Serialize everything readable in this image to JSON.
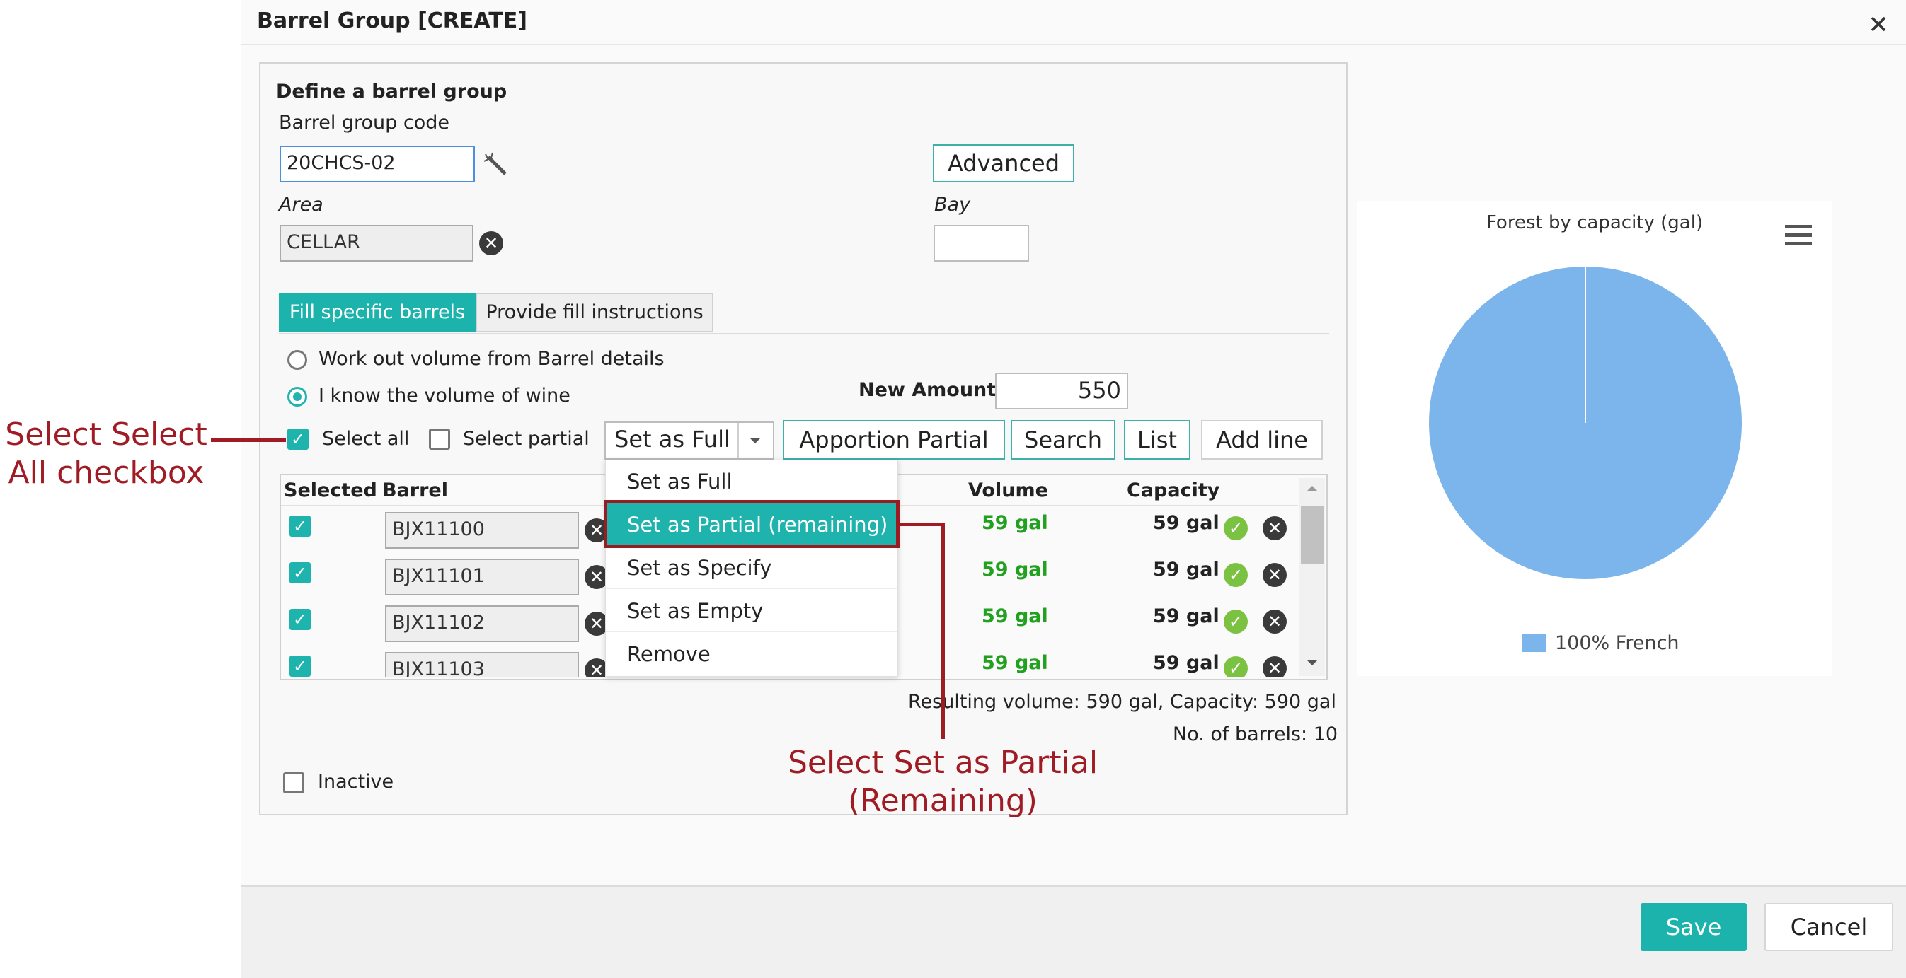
{
  "dialog": {
    "title": "Barrel Group [CREATE]"
  },
  "form": {
    "section_title": "Define a barrel group",
    "code_label": "Barrel group code",
    "code_value": "20CHCS-02",
    "advanced_label": "Advanced",
    "area_label": "Area",
    "area_value": "CELLAR",
    "bay_label": "Bay",
    "bay_value": ""
  },
  "tabs": [
    {
      "label": "Fill specific barrels",
      "active": true
    },
    {
      "label": "Provide fill instructions",
      "active": false
    }
  ],
  "volume_mode": {
    "option1": "Work out volume from Barrel details",
    "option2": "I know the volume of wine",
    "selected": 2
  },
  "new_amount": {
    "label": "New Amount",
    "value": "550"
  },
  "toolbar": {
    "select_all": "Select all",
    "select_partial": "Select partial",
    "fill_select": "Set as Full",
    "apportion": "Apportion Partial",
    "search": "Search",
    "list": "List",
    "add_line": "Add line"
  },
  "dropdown": {
    "items": [
      "Set as Full",
      "Set as Partial (remaining)",
      "Set as Specify",
      "Set as Empty",
      "Remove"
    ],
    "highlighted": 1
  },
  "table": {
    "headers": {
      "selected": "Selected",
      "barrel": "Barrel",
      "volume": "Volume",
      "capacity": "Capacity"
    },
    "rows": [
      {
        "barrel": "BJX11100",
        "volume": "59 gal",
        "capacity": "59 gal",
        "selected": true
      },
      {
        "barrel": "BJX11101",
        "volume": "59 gal",
        "capacity": "59 gal",
        "selected": true
      },
      {
        "barrel": "BJX11102",
        "volume": "59 gal",
        "capacity": "59 gal",
        "selected": true
      },
      {
        "barrel": "BJX11103",
        "volume": "59 gal",
        "capacity": "59 gal",
        "selected": true
      }
    ]
  },
  "summary": {
    "resulting": "Resulting volume: 590 gal, Capacity: 590 gal",
    "count": "No. of barrels: 10"
  },
  "inactive_label": "Inactive",
  "chart_data": {
    "type": "pie",
    "title": "Forest by capacity (gal)",
    "series": [
      {
        "name": "100% French",
        "values": [
          100
        ],
        "color": "#7cb5ec"
      }
    ],
    "legend_position": "bottom"
  },
  "annotations": {
    "select_all": [
      "Select Select",
      "All checkbox"
    ],
    "set_partial": [
      "Select Set as Partial",
      "(Remaining)"
    ],
    "color": "#a01c24"
  },
  "footer": {
    "save": "Save",
    "cancel": "Cancel"
  },
  "colors": {
    "accent": "#1cb3ad",
    "annotation": "#a01c24",
    "volume_green": "#22a020"
  }
}
